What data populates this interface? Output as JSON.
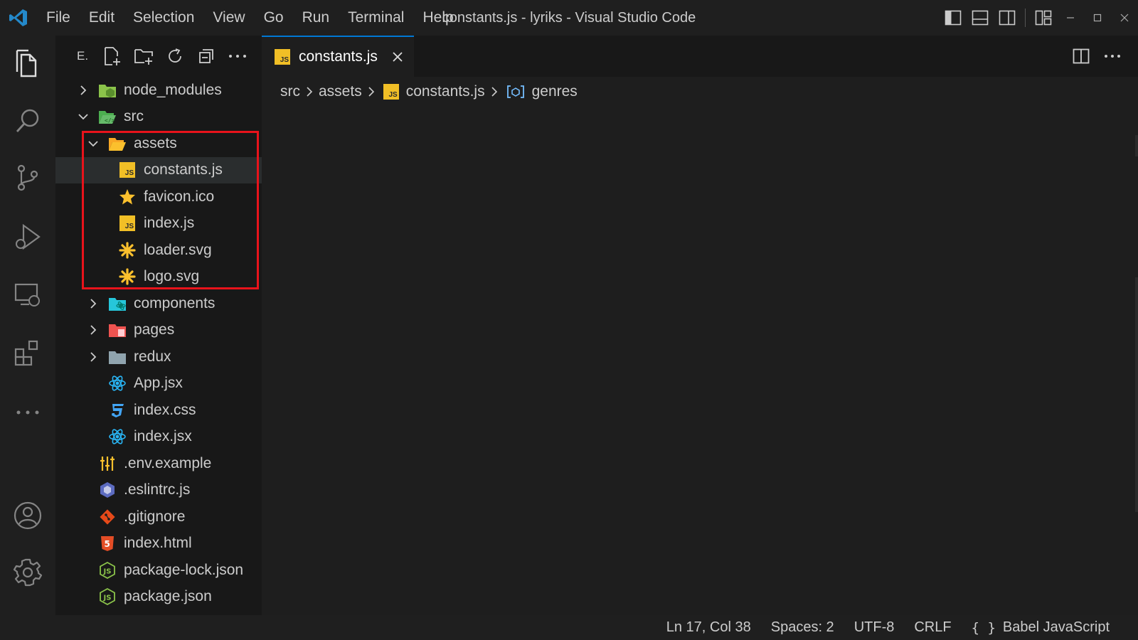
{
  "window": {
    "title": "constants.js - lyriks - Visual Studio Code"
  },
  "menu": [
    "File",
    "Edit",
    "Selection",
    "View",
    "Go",
    "Run",
    "Terminal",
    "Help"
  ],
  "explorer": {
    "title": "E.",
    "tree": [
      {
        "label": "node_modules",
        "type": "folder",
        "expanded": false
      },
      {
        "label": "src",
        "type": "folder",
        "expanded": true
      },
      {
        "label": "assets",
        "type": "folder",
        "expanded": true
      },
      {
        "label": "constants.js",
        "type": "js",
        "selected": true
      },
      {
        "label": "favicon.ico",
        "type": "ico"
      },
      {
        "label": "index.js",
        "type": "js"
      },
      {
        "label": "loader.svg",
        "type": "svg"
      },
      {
        "label": "logo.svg",
        "type": "svg"
      },
      {
        "label": "components",
        "type": "folder",
        "expanded": false
      },
      {
        "label": "pages",
        "type": "folder",
        "expanded": false
      },
      {
        "label": "redux",
        "type": "folder",
        "expanded": false
      },
      {
        "label": "App.jsx",
        "type": "react"
      },
      {
        "label": "index.css",
        "type": "css"
      },
      {
        "label": "index.jsx",
        "type": "react"
      },
      {
        "label": ".env.example",
        "type": "env"
      },
      {
        "label": ".eslintrc.js",
        "type": "eslint"
      },
      {
        "label": ".gitignore",
        "type": "git"
      },
      {
        "label": "index.html",
        "type": "html"
      },
      {
        "label": "package-lock.json",
        "type": "node"
      },
      {
        "label": "package.json",
        "type": "node"
      }
    ]
  },
  "tab": {
    "label": "constants.js",
    "icon": "JS"
  },
  "breadcrumb": {
    "parts": [
      "src",
      "assets",
      "constants.js",
      "genres"
    ]
  },
  "status": {
    "position": "Ln 17, Col 38",
    "spaces": "Spaces: 2",
    "encoding": "UTF-8",
    "eol": "CRLF",
    "language_braces": "{ }",
    "language": "Babel JavaScript"
  },
  "colors": {
    "accent": "#0078d4",
    "highlight_box": "#e8131b",
    "js_yellow": "#f1bf26"
  }
}
